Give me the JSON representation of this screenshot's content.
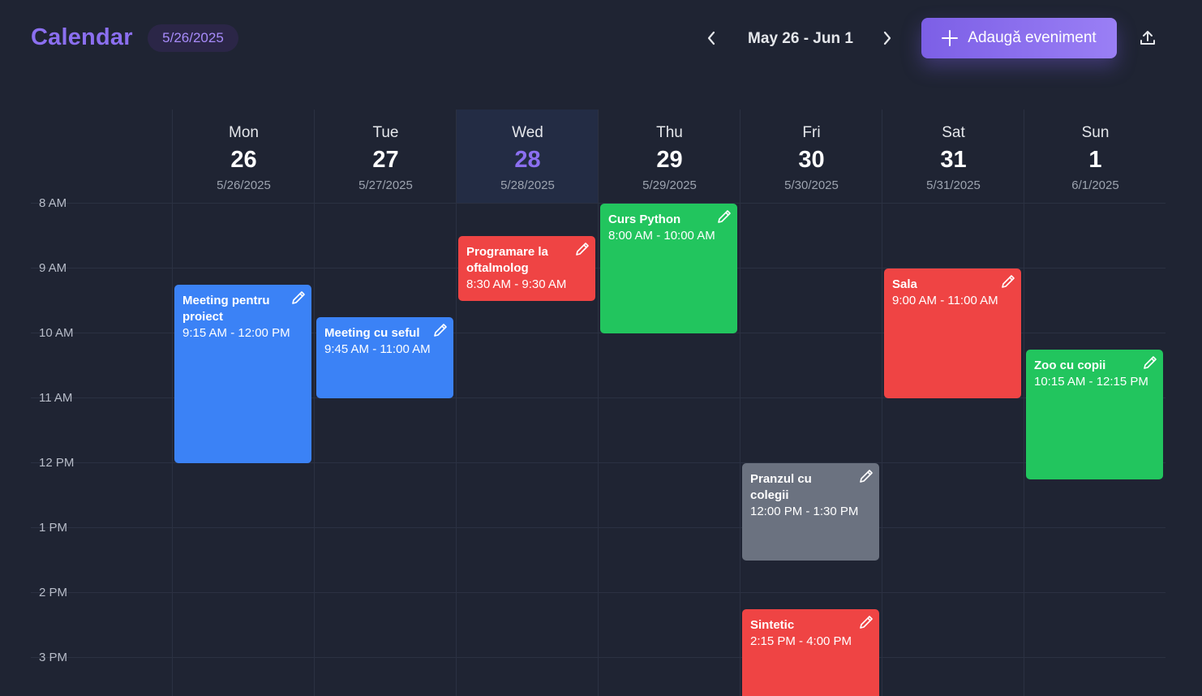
{
  "header": {
    "title": "Calendar",
    "current_date": "5/26/2025",
    "range": "May 26 - Jun 1",
    "add_label": "Adaugă eveniment"
  },
  "days": [
    {
      "name": "Mon",
      "num": "26",
      "date": "5/26/2025"
    },
    {
      "name": "Tue",
      "num": "27",
      "date": "5/27/2025"
    },
    {
      "name": "Wed",
      "num": "28",
      "date": "5/28/2025"
    },
    {
      "name": "Thu",
      "num": "29",
      "date": "5/29/2025"
    },
    {
      "name": "Fri",
      "num": "30",
      "date": "5/30/2025"
    },
    {
      "name": "Sat",
      "num": "31",
      "date": "5/31/2025"
    },
    {
      "name": "Sun",
      "num": "1",
      "date": "6/1/2025"
    }
  ],
  "today_index": 2,
  "hours": [
    "8 AM",
    "9 AM",
    "10 AM",
    "11 AM",
    "12 PM",
    "1 PM",
    "2 PM",
    "3 PM"
  ],
  "events": [
    {
      "title": "Meeting pentru proiect",
      "time": "9:15 AM - 12:00 PM"
    },
    {
      "title": "Meeting cu seful",
      "time": "9:45 AM - 11:00 AM"
    },
    {
      "title": "Programare la oftalmolog",
      "time": "8:30 AM - 9:30 AM"
    },
    {
      "title": "Curs Python",
      "time": "8:00 AM - 10:00 AM"
    },
    {
      "title": "Pranzul cu colegii",
      "time": "12:00 PM - 1:30 PM"
    },
    {
      "title": "Sintetic",
      "time": "2:15 PM - 4:00 PM"
    },
    {
      "title": "Sala",
      "time": "9:00 AM - 11:00 AM"
    },
    {
      "title": "Zoo cu copii",
      "time": "10:15 AM - 12:15 PM"
    }
  ],
  "colors": {
    "background": "#1f2433",
    "accent": "#8b6ff0",
    "blue": "#3b82f6",
    "red": "#ef4444",
    "green": "#22c55e",
    "gray": "#6b7280"
  }
}
